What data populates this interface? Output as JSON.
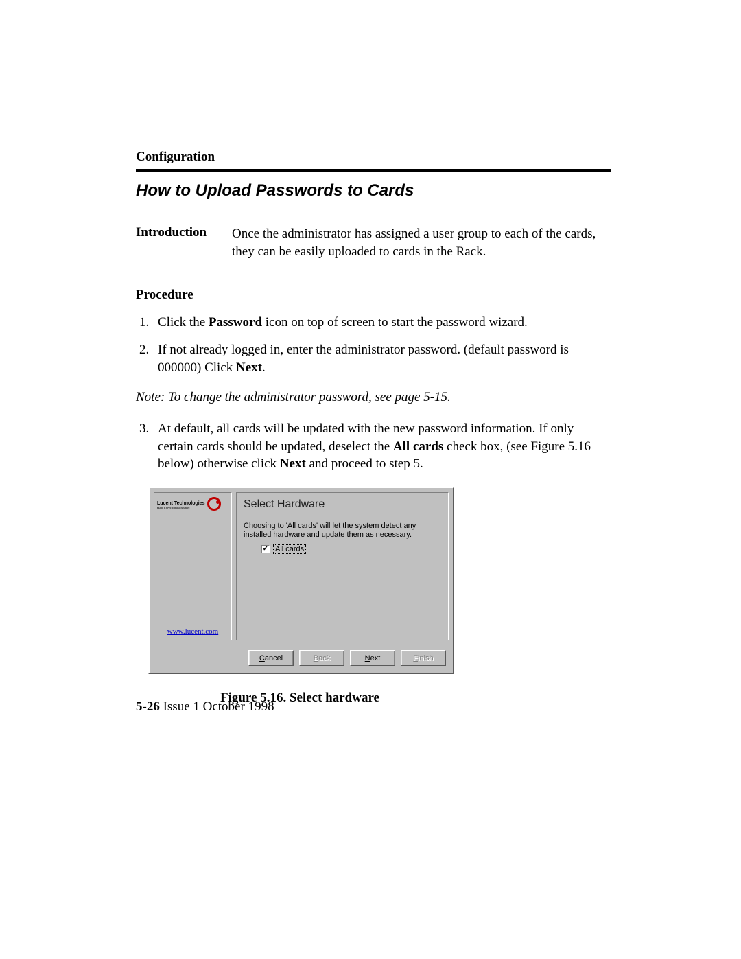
{
  "chapter": "Configuration",
  "section_title": "How to Upload Passwords to Cards",
  "introduction": {
    "label": "Introduction",
    "text": "Once the administrator has assigned a user group to each of the cards, they can be easily uploaded to cards in the Rack."
  },
  "procedure_heading": "Procedure",
  "steps": {
    "s1_a": "Click the ",
    "s1_bold": "Password",
    "s1_b": " icon on top of screen to start the password wizard.",
    "s2_a": "If not already logged in, enter the administrator password. (default password is 000000) Click ",
    "s2_bold": "Next",
    "s2_b": ".",
    "s3_a": "At default, all cards will be updated with the new password information. If only certain cards should be updated, deselect the ",
    "s3_bold1": "All cards",
    "s3_b": " check box, (see Figure 5.16 below) otherwise click ",
    "s3_bold2": "Next",
    "s3_c": " and proceed to step 5."
  },
  "note": "Note: To change the administrator  password, see page 5-15.",
  "wizard": {
    "brand_text": "Lucent Technologies",
    "brand_sub": "Bell Labs Innovations",
    "sidebar_link": "www.lucent.com",
    "title": "Select Hardware",
    "description": "Choosing to 'All cards' will let the system detect any installed hardware and update them as necessary.",
    "checkbox_label": "All cards",
    "checkbox_mark": "✓",
    "buttons": {
      "cancel_u": "C",
      "cancel_rest": "ancel",
      "back_u": "B",
      "back_rest": "ack",
      "next_u": "N",
      "next_rest": "ext",
      "finish_u": "F",
      "finish_rest": "inish"
    }
  },
  "figure_caption": "Figure 5.16. Select hardware",
  "footer": {
    "page": "5-26",
    "issue": " Issue 1 October 1998"
  }
}
